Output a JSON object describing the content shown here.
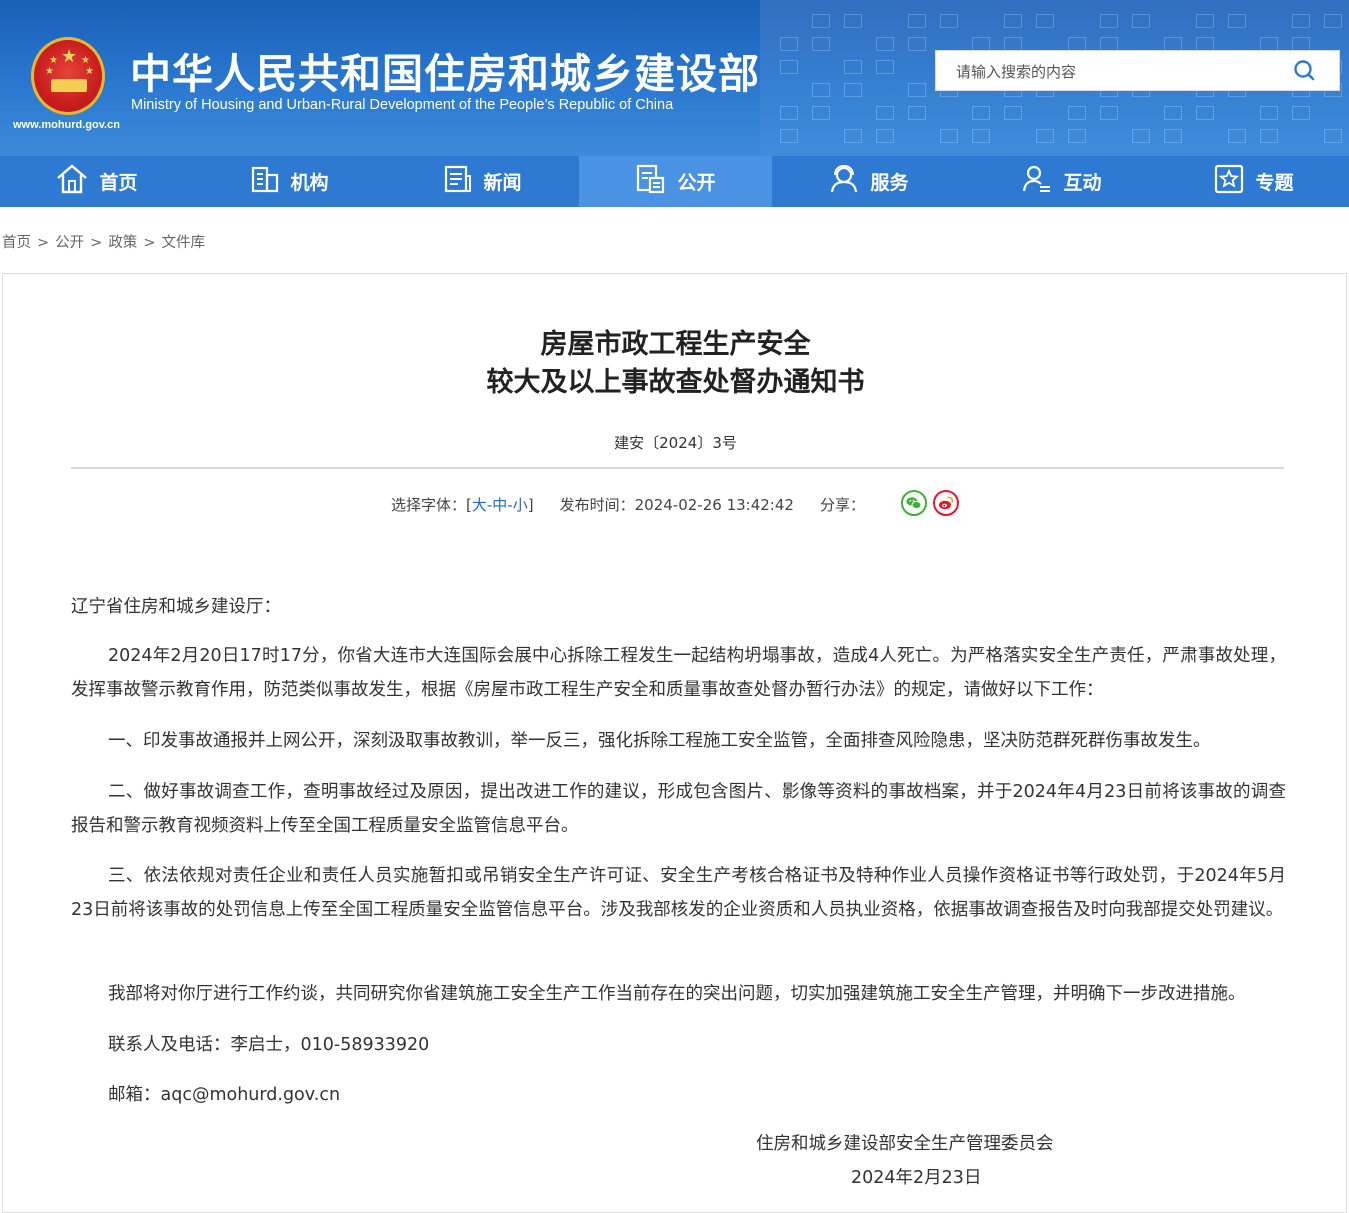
{
  "header": {
    "site_title": "中华人民共和国住房和城乡建设部",
    "site_subtitle": "Ministry of Housing and Urban-Rural Development of the People’s Republic of China",
    "site_url": "www.mohurd.gov.cn",
    "search_placeholder": "请输入搜索的内容"
  },
  "nav": {
    "items": [
      {
        "label": "首页",
        "icon": "home-icon"
      },
      {
        "label": "机构",
        "icon": "building-icon"
      },
      {
        "label": "新闻",
        "icon": "news-icon"
      },
      {
        "label": "公开",
        "icon": "document-icon",
        "active": true
      },
      {
        "label": "服务",
        "icon": "service-icon"
      },
      {
        "label": "互动",
        "icon": "interaction-icon"
      },
      {
        "label": "专题",
        "icon": "star-icon"
      }
    ]
  },
  "breadcrumb": [
    "首页",
    "公开",
    "政策",
    "文件库"
  ],
  "breadcrumb_sep": ">",
  "article": {
    "title_line1": "房屋市政工程生产安全",
    "title_line2": "较大及以上事故查处督办通知书",
    "doc_number": "建安〔2024〕3号",
    "font_label": "选择字体：[",
    "font_large": "大",
    "font_medium": "中",
    "font_small": "小",
    "font_dash": "-",
    "font_close": "]",
    "publish_label": "发布时间：",
    "publish_time": "2024-02-26 13:42:42",
    "share_label": "分享：",
    "salutation": "辽宁省住房和城乡建设厅：",
    "paragraphs": [
      "2024年2月20日17时17分，你省大连市大连国际会展中心拆除工程发生一起结构坍塌事故，造成4人死亡。为严格落实安全生产责任，严肃事故处理，发挥事故警示教育作用，防范类似事故发生，根据《房屋市政工程生产安全和质量事故查处督办暂行办法》的规定，请做好以下工作：",
      "一、印发事故通报并上网公开，深刻汲取事故教训，举一反三，强化拆除工程施工安全监管，全面排查风险隐患，坚决防范群死群伤事故发生。",
      "二、做好事故调查工作，查明事故经过及原因，提出改进工作的建议，形成包含图片、影像等资料的事故档案，并于2024年4月23日前将该事故的调查报告和警示教育视频资料上传至全国工程质量安全监管信息平台。",
      "三、依法依规对责任企业和责任人员实施暂扣或吊销安全生产许可证、安全生产考核合格证书及特种作业人员操作资格证书等行政处罚，于2024年5月23日前将该事故的处罚信息上传至全国工程质量安全监管信息平台。涉及我部核发的企业资质和人员执业资格，依据事故调查报告及时向我部提交处罚建议。",
      "我部将对你厅进行工作约谈，共同研究你省建筑施工安全生产工作当前存在的突出问题，切实加强建筑施工安全生产管理，并明确下一步改进措施。",
      "联系人及电话：李启士，010-58933920",
      "邮箱：aqc@mohurd.gov.cn"
    ],
    "signatory": "住房和城乡建设部安全生产管理委员会",
    "sign_date": "2024年2月23日"
  },
  "colors": {
    "header_blue": "#1a5fb8",
    "nav_blue": "#2e7ad3",
    "nav_active": "#4a92e3",
    "link_blue": "#2568c4",
    "wechat_green": "#3eb135",
    "weibo_red": "#e6162d"
  }
}
